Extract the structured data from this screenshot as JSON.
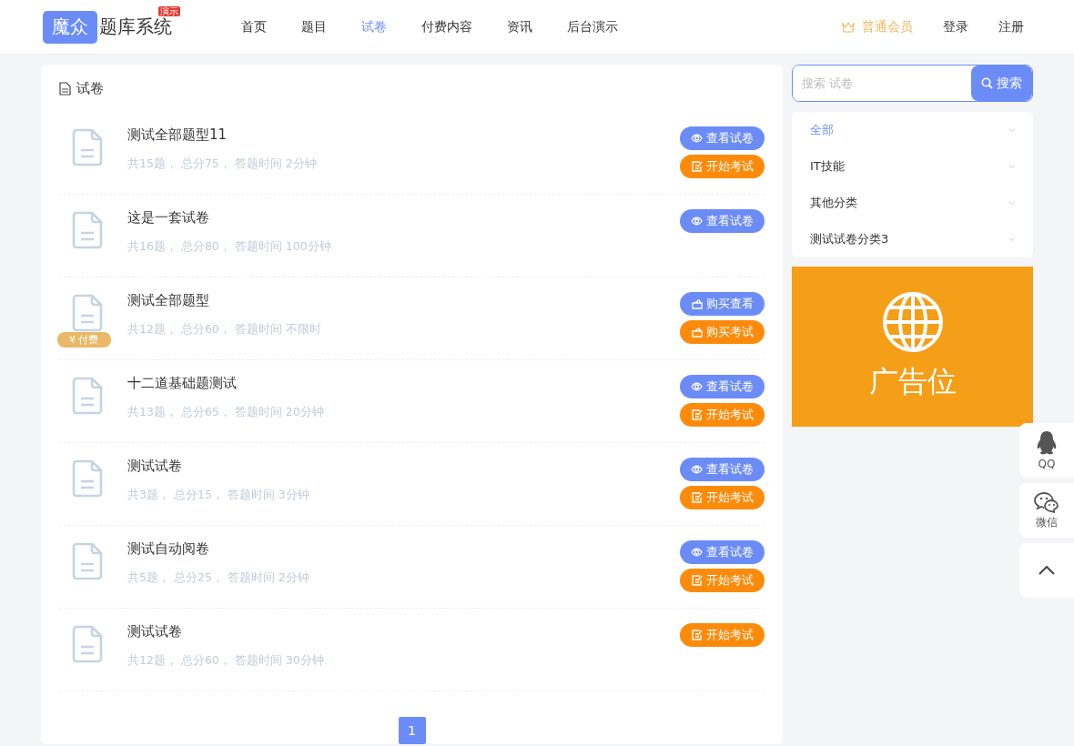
{
  "header": {
    "logo_mark": "魔众",
    "logo_text": "题库系统",
    "logo_badge": "演示",
    "nav": [
      {
        "label": "首页",
        "selected": false
      },
      {
        "label": "题目",
        "selected": false
      },
      {
        "label": "试卷",
        "selected": true
      },
      {
        "label": "付费内容",
        "selected": false
      },
      {
        "label": "资讯",
        "selected": false
      },
      {
        "label": "后台演示",
        "selected": false
      }
    ],
    "member": "普通会员",
    "login": "登录",
    "register": "注册"
  },
  "panel": {
    "title": "试卷",
    "papers": [
      {
        "title": "测试全部题型11",
        "meta": "共15题， 总分75， 答题时间 2分钟",
        "buttons": [
          {
            "kind": "view",
            "label": "查看试卷"
          },
          {
            "kind": "start",
            "label": "开始考试"
          }
        ]
      },
      {
        "title": "这是一套试卷",
        "meta": "共16题， 总分80， 答题时间 100分钟",
        "buttons": [
          {
            "kind": "view",
            "label": "查看试卷"
          }
        ]
      },
      {
        "title": "测试全部题型",
        "meta": "共12题， 总分60， 答题时间 不限时",
        "badge": "¥ 付费",
        "buttons": [
          {
            "kind": "buy-view",
            "label": "购买查看"
          },
          {
            "kind": "buy-start",
            "label": "购买考试"
          }
        ]
      },
      {
        "title": "十二道基础题测试",
        "meta": "共13题， 总分65， 答题时间 20分钟",
        "buttons": [
          {
            "kind": "view",
            "label": "查看试卷"
          },
          {
            "kind": "start",
            "label": "开始考试"
          }
        ]
      },
      {
        "title": "测试试卷",
        "meta": "共3题， 总分15， 答题时间 3分钟",
        "buttons": [
          {
            "kind": "view",
            "label": "查看试卷"
          },
          {
            "kind": "start",
            "label": "开始考试"
          }
        ]
      },
      {
        "title": "测试自动阅卷",
        "meta": "共5题， 总分25， 答题时间 2分钟",
        "buttons": [
          {
            "kind": "view",
            "label": "查看试卷"
          },
          {
            "kind": "start",
            "label": "开始考试"
          }
        ]
      },
      {
        "title": "测试试卷",
        "meta": "共12题， 总分60， 答题时间 30分钟",
        "buttons": [
          {
            "kind": "start",
            "label": "开始考试"
          }
        ]
      }
    ],
    "pagination": [
      {
        "label": "1",
        "selected": true
      }
    ]
  },
  "sidebar": {
    "search": {
      "placeholder": "搜索 试卷",
      "button": "搜索"
    },
    "categories": [
      {
        "label": "全部",
        "selected": true
      },
      {
        "label": "IT技能",
        "selected": false
      },
      {
        "label": "其他分类",
        "selected": false
      },
      {
        "label": "测试试卷分类3",
        "selected": false
      }
    ],
    "ad": "广告位"
  },
  "side_tools": [
    {
      "kind": "qq",
      "label": "QQ"
    },
    {
      "kind": "wechat",
      "label": "微信"
    },
    {
      "kind": "top"
    }
  ]
}
